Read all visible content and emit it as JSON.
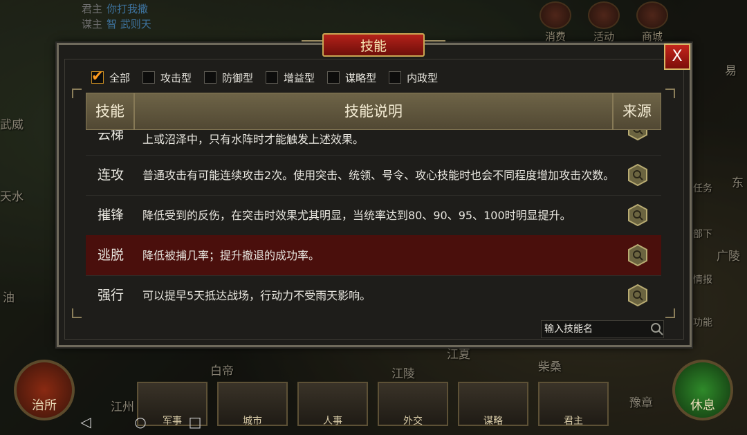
{
  "top": {
    "lord_label": "君主",
    "lord_value": "你打我撒",
    "advisor_label": "谋主",
    "advisor_value": "智 武则天",
    "icons": [
      {
        "label": "消费",
        "icon": "coin-icon"
      },
      {
        "label": "活动",
        "icon": "event-icon"
      },
      {
        "label": "商城",
        "icon": "shop-icon"
      }
    ]
  },
  "map_labels": [
    "武威",
    "天水",
    "油",
    "易",
    "东",
    "任务",
    "部下",
    "情报",
    "功能",
    "广陵",
    "白帝",
    "江陵",
    "江夏",
    "柴桑",
    "江州",
    "豫章"
  ],
  "dialog": {
    "title": "技能",
    "close_label": "X",
    "filters": [
      {
        "label": "全部",
        "checked": true
      },
      {
        "label": "攻击型",
        "checked": false
      },
      {
        "label": "防御型",
        "checked": false
      },
      {
        "label": "增益型",
        "checked": false
      },
      {
        "label": "谋略型",
        "checked": false
      },
      {
        "label": "内政型",
        "checked": false
      }
    ],
    "columns": [
      "技能",
      "技能说明",
      "来源"
    ],
    "rows": [
      {
        "name": "云梯",
        "desc": "上或沼泽中，只有水阵时才能触发上述效果。",
        "selected": false
      },
      {
        "name": "连攻",
        "desc": "普通攻击有可能连续攻击2次。使用突击、统领、号令、攻心技能时也会不同程度增加攻击次数。",
        "selected": false
      },
      {
        "name": "摧锋",
        "desc": "降低受到的反伤，在突击时效果尤其明显，当统率达到80、90、95、100时明显提升。",
        "selected": false
      },
      {
        "name": "逃脱",
        "desc": "降低被捕几率；提升撤退的成功率。",
        "selected": true
      },
      {
        "name": "强行",
        "desc": "可以提早5天抵达战场，行动力不受雨天影响。",
        "selected": false
      }
    ],
    "search_placeholder": "输入技能名"
  },
  "bottom": {
    "left_button": "治所",
    "right_button": "休息",
    "commands": [
      "军事",
      "城市",
      "人事",
      "外交",
      "谋略",
      "君主"
    ]
  },
  "colors": {
    "accent_red": "#b4221a",
    "gold": "#c9a653",
    "selected_row": "#4a0f0c",
    "link_blue": "#5fb0f2"
  }
}
